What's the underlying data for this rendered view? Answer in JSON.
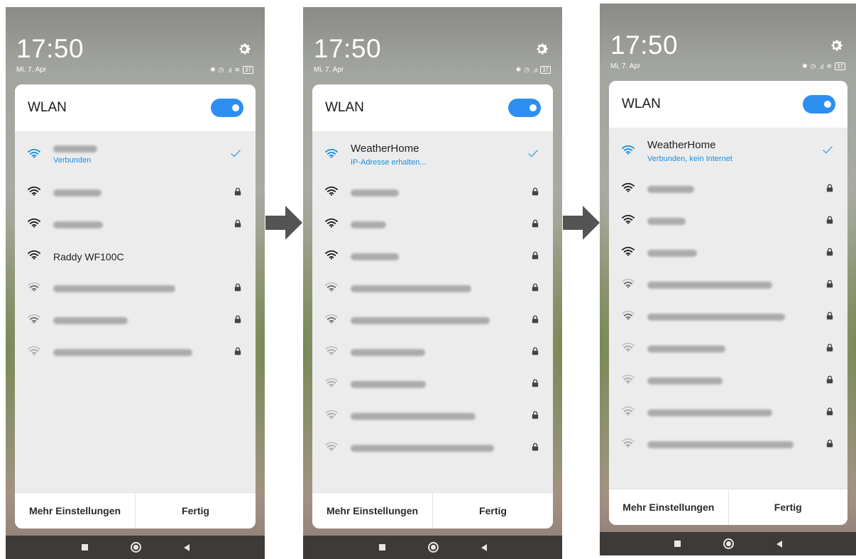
{
  "arrows": [
    "arrow-right-icon",
    "arrow-right-icon"
  ],
  "screens": [
    {
      "time": "17:50",
      "date": "Mi, 7. Apr",
      "battery": "37",
      "panel_title": "WLAN",
      "wifi_enabled": true,
      "networks": [
        {
          "name": "",
          "status": "Verbunden",
          "connected": true,
          "signal": "blue",
          "locked": false,
          "blur_width": 62
        },
        {
          "name": "",
          "signal": "strong",
          "locked": true,
          "blur_width": 68
        },
        {
          "name": "",
          "signal": "strong",
          "locked": true,
          "blur_width": 70
        },
        {
          "name": "Raddy WF100C",
          "signal": "strong",
          "locked": false
        },
        {
          "name": "",
          "signal": "medium",
          "locked": true,
          "blur_width": 172
        },
        {
          "name": "",
          "signal": "medium",
          "locked": true,
          "blur_width": 105
        },
        {
          "name": "",
          "signal": "weak",
          "locked": true,
          "blur_width": 196
        }
      ],
      "footer": {
        "more_settings": "Mehr Einstellungen",
        "done": "Fertig"
      }
    },
    {
      "time": "17:50",
      "date": "Mi, 7. Apr",
      "battery": "37",
      "panel_title": "WLAN",
      "wifi_enabled": true,
      "networks": [
        {
          "name": "WeatherHome",
          "status": "IP-Adresse erhalten...",
          "connected": true,
          "signal": "blue",
          "locked": false
        },
        {
          "name": "",
          "signal": "strong",
          "locked": true,
          "blur_width": 68
        },
        {
          "name": "",
          "signal": "strong",
          "locked": true,
          "blur_width": 50
        },
        {
          "name": "",
          "signal": "strong",
          "locked": true,
          "blur_width": 68
        },
        {
          "name": "",
          "signal": "medium",
          "locked": true,
          "blur_width": 170
        },
        {
          "name": "",
          "signal": "medium",
          "locked": true,
          "blur_width": 196
        },
        {
          "name": "",
          "signal": "weak",
          "locked": true,
          "blur_width": 105
        },
        {
          "name": "",
          "signal": "weak",
          "locked": true,
          "blur_width": 106
        },
        {
          "name": "",
          "signal": "weak",
          "locked": true,
          "blur_width": 176
        },
        {
          "name": "",
          "signal": "weak",
          "locked": true,
          "blur_width": 202
        }
      ],
      "footer": {
        "more_settings": "Mehr Einstellungen",
        "done": "Fertig"
      }
    },
    {
      "time": "17:50",
      "date": "Mi, 7. Apr",
      "battery": "37",
      "panel_title": "WLAN",
      "wifi_enabled": true,
      "networks": [
        {
          "name": "WeatherHome",
          "status": "Verbunden, kein Internet",
          "connected": true,
          "signal": "blue",
          "locked": false
        },
        {
          "name": "",
          "signal": "strong",
          "locked": true,
          "blur_width": 66
        },
        {
          "name": "",
          "signal": "strong",
          "locked": true,
          "blur_width": 54
        },
        {
          "name": "",
          "signal": "strong",
          "locked": true,
          "blur_width": 70
        },
        {
          "name": "",
          "signal": "medium",
          "locked": true,
          "blur_width": 176
        },
        {
          "name": "",
          "signal": "medium",
          "locked": true,
          "blur_width": 194
        },
        {
          "name": "",
          "signal": "weak",
          "locked": true,
          "blur_width": 110
        },
        {
          "name": "",
          "signal": "weak",
          "locked": true,
          "blur_width": 106
        },
        {
          "name": "",
          "signal": "weak",
          "locked": true,
          "blur_width": 176
        },
        {
          "name": "",
          "signal": "weak",
          "locked": true,
          "blur_width": 206
        }
      ],
      "footer": {
        "more_settings": "Mehr Einstellungen",
        "done": "Fertig"
      }
    }
  ]
}
